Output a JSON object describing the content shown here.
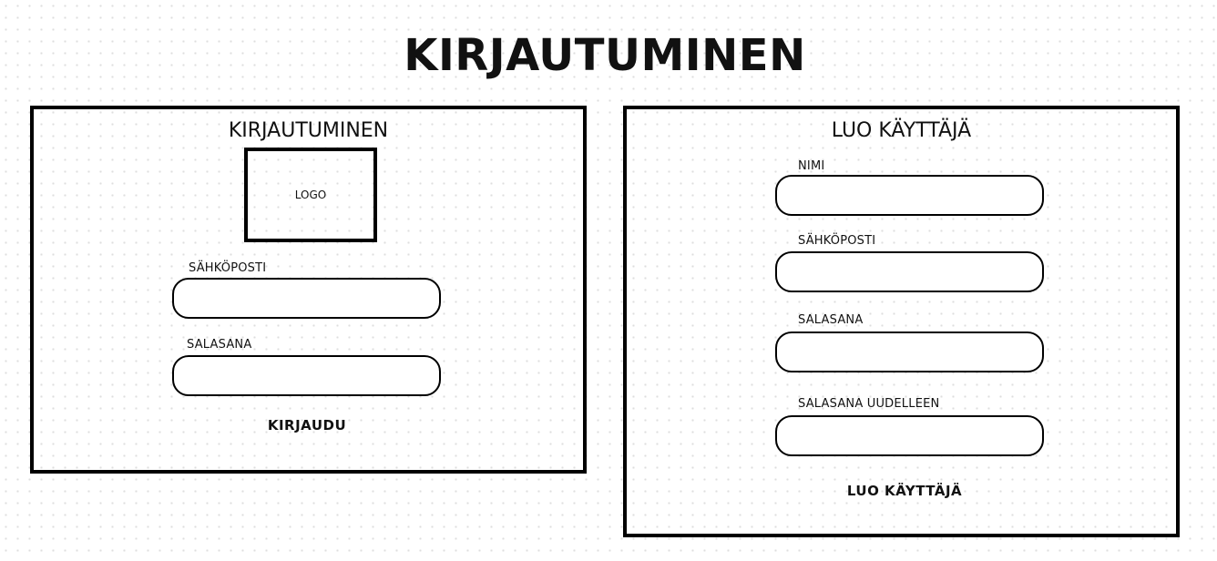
{
  "page": {
    "title": "KIRJAUTUMINEN"
  },
  "login_panel": {
    "title": "KIRJAUTUMINEN",
    "logo_text": "LOGO",
    "email_label": "SÄHKÖPOSTI",
    "email_value": "",
    "password_label": "SALASANA",
    "password_value": "",
    "submit_label": "KIRJAUDU"
  },
  "register_panel": {
    "title": "LUO KÄYTTÄJÄ",
    "name_label": "NIMI",
    "name_value": "",
    "email_label": "SÄHKÖPOSTI",
    "email_value": "",
    "password_label": "SALASANA",
    "password_value": "",
    "password_repeat_label": "SALASANA UUDELLEEN",
    "password_repeat_value": "",
    "submit_label": "LUO KÄYTTÄJÄ"
  }
}
